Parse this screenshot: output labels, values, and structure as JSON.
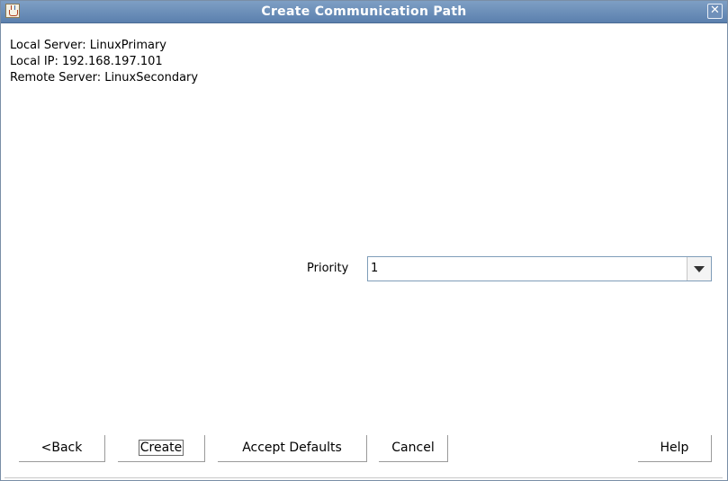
{
  "window": {
    "title": "Create Communication Path",
    "close_label": "✕"
  },
  "info": {
    "local_server": "Local Server: LinuxPrimary",
    "local_ip": "Local IP: 192.168.197.101",
    "remote_server": "Remote Server: LinuxSecondary"
  },
  "priority": {
    "label": "Priority",
    "value": "1"
  },
  "buttons": {
    "back": "<Back",
    "create": "Create",
    "accept_defaults": "Accept Defaults",
    "cancel": "Cancel",
    "help": "Help"
  }
}
